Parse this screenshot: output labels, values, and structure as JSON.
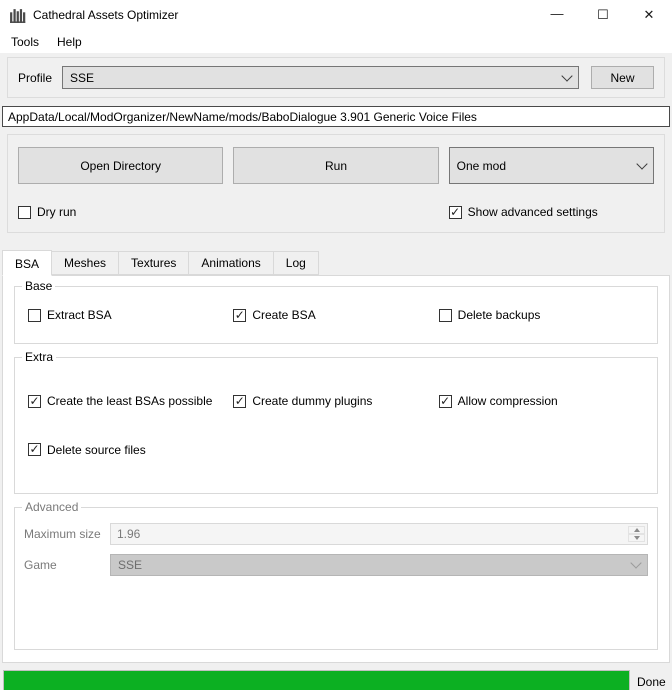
{
  "colors": {
    "progress_green": "#0cb022",
    "window_bg": "#f0f0f0",
    "titlebar_bg": "#ffffff"
  },
  "icons": {
    "app": "cathedral-organ-icon",
    "minimize_glyph": "—",
    "maximize_glyph": "☐",
    "close_glyph": "✕",
    "check_glyph": "✓"
  },
  "window": {
    "title": "Cathedral Assets Optimizer"
  },
  "menubar": {
    "items": [
      {
        "label": "Tools"
      },
      {
        "label": "Help"
      }
    ]
  },
  "profile_row": {
    "label": "Profile",
    "selected": "SSE",
    "new_button": "New"
  },
  "path_field": {
    "value": "AppData/Local/ModOrganizer/NewName/mods/BaboDialogue 3.901 Generic Voice Files"
  },
  "actions": {
    "open_directory": "Open Directory",
    "run": "Run",
    "mode_select": {
      "selected": "One mod"
    },
    "dry_run": {
      "label": "Dry run",
      "checked": false
    },
    "show_advanced": {
      "label": "Show advanced settings",
      "checked": true
    }
  },
  "tabs": [
    {
      "label": "BSA",
      "active": true
    },
    {
      "label": "Meshes",
      "active": false
    },
    {
      "label": "Textures",
      "active": false
    },
    {
      "label": "Animations",
      "active": false
    },
    {
      "label": "Log",
      "active": false
    }
  ],
  "bsa_tab": {
    "base": {
      "title": "Base",
      "items": [
        {
          "label": "Extract BSA",
          "checked": false
        },
        {
          "label": "Create BSA",
          "checked": true
        },
        {
          "label": "Delete backups",
          "checked": false
        }
      ]
    },
    "extra": {
      "title": "Extra",
      "row1": [
        {
          "label": "Create the least BSAs possible",
          "checked": true
        },
        {
          "label": "Create dummy plugins",
          "checked": true
        },
        {
          "label": "Allow compression",
          "checked": true
        }
      ],
      "row2": [
        {
          "label": "Delete source files",
          "checked": true
        }
      ]
    },
    "advanced": {
      "title": "Advanced",
      "disabled": true,
      "maximum_size": {
        "label": "Maximum size",
        "value": "1.96"
      },
      "game": {
        "label": "Game",
        "selected": "SSE"
      }
    }
  },
  "progress": {
    "percent": 100,
    "status": "Done"
  }
}
